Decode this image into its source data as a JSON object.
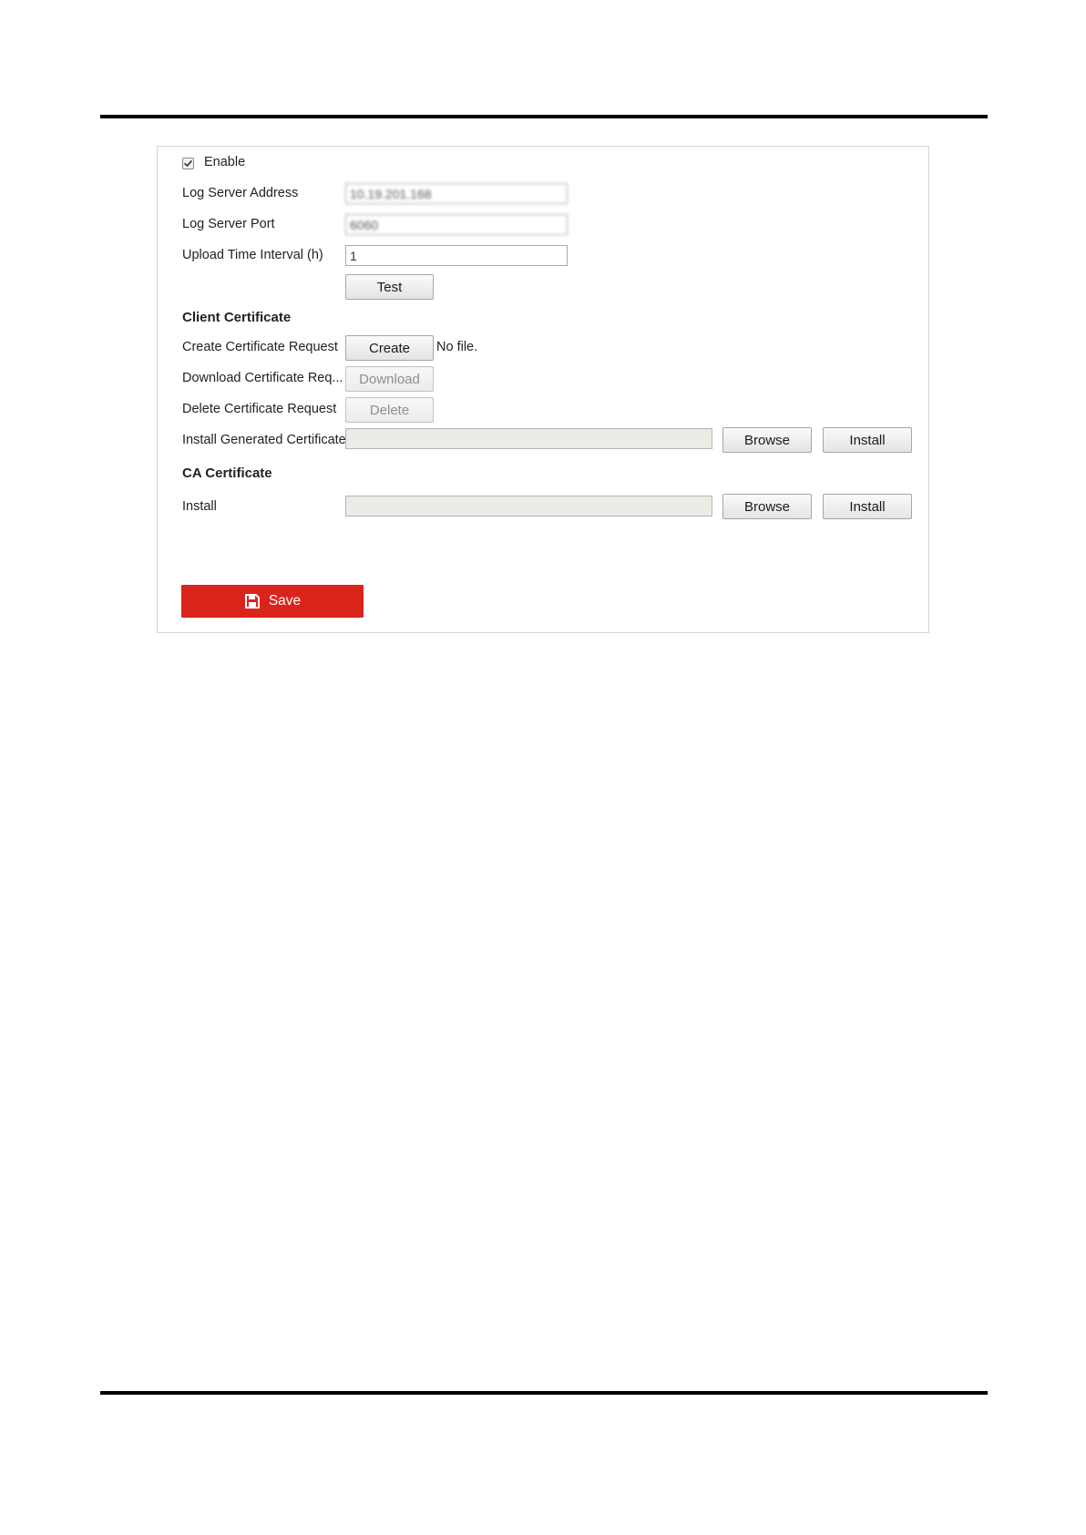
{
  "form": {
    "enable": {
      "label": "Enable",
      "checked": true
    },
    "log_server_address": {
      "label": "Log Server Address",
      "value": "10.19.201.168"
    },
    "log_server_port": {
      "label": "Log Server Port",
      "value": "6060"
    },
    "upload_time_interval": {
      "label": "Upload Time Interval (h)",
      "value": "1"
    },
    "test_label": "Test"
  },
  "client_certificate": {
    "heading": "Client Certificate",
    "create_request": {
      "label": "Create Certificate Request",
      "button": "Create",
      "status": "No file."
    },
    "download_request": {
      "label": "Download Certificate Req...",
      "button": "Download"
    },
    "delete_request": {
      "label": "Delete Certificate Request",
      "button": "Delete"
    },
    "install_generated": {
      "label": "Install Generated Certificate",
      "browse": "Browse",
      "install": "Install"
    }
  },
  "ca_certificate": {
    "heading": "CA Certificate",
    "install": {
      "label": "Install",
      "browse": "Browse",
      "install": "Install"
    }
  },
  "save_label": "Save",
  "icons": {
    "checkbox": "check-icon",
    "save": "floppy-disk-icon"
  },
  "colors": {
    "accent": "#d9241c",
    "field_disabled_bg": "#ecebe6",
    "rule": "#000000"
  }
}
